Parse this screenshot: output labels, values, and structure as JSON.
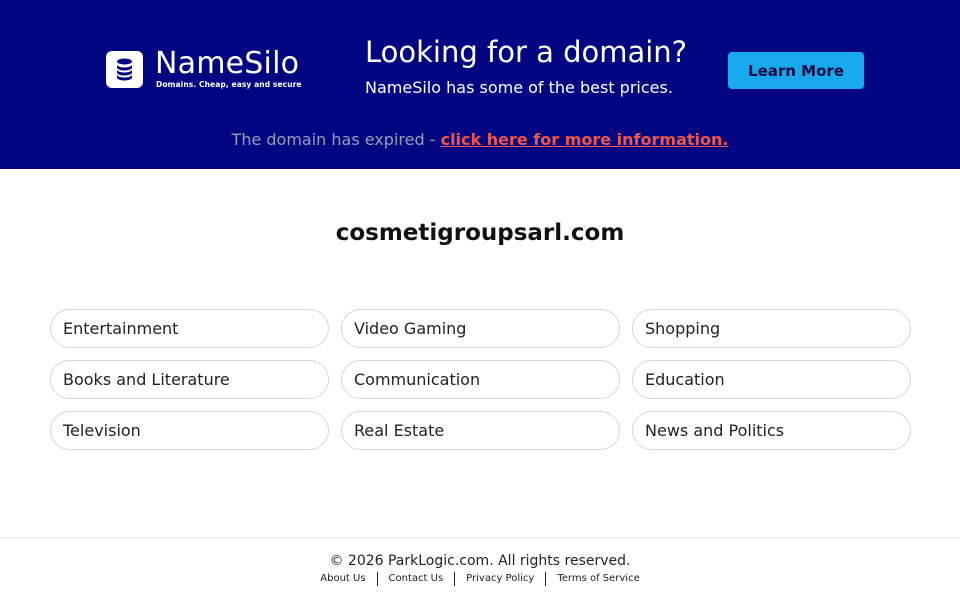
{
  "banner": {
    "logo": {
      "name": "NameSilo",
      "tagline": "Domains. Cheap, easy and secure",
      "icon": "database-icon"
    },
    "promo_title": "Looking for a domain?",
    "promo_subtitle": "NameSilo has some of the best prices.",
    "learn_more_label": "Learn More",
    "expired_text": "The domain has expired - ",
    "expired_link": "click here for more information.",
    "colors": {
      "background": "#020781",
      "button": "#18a9ec",
      "link": "#f0554c"
    }
  },
  "main": {
    "domain": "cosmetigroupsarl.com",
    "topics": [
      "Entertainment",
      "Video Gaming",
      "Shopping",
      "Books and Literature",
      "Communication",
      "Education",
      "Television",
      "Real Estate",
      "News and Politics"
    ]
  },
  "footer": {
    "copyright": "© 2026 ParkLogic.com. All rights reserved.",
    "links": [
      "About Us",
      "Contact Us",
      "Privacy Policy",
      "Terms of Service"
    ]
  }
}
